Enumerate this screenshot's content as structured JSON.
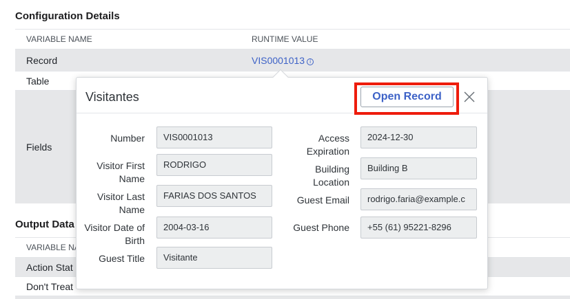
{
  "config": {
    "title": "Configuration Details",
    "col_name": "VARIABLE NAME",
    "col_value": "RUNTIME VALUE",
    "rows": [
      {
        "name": "Record",
        "value": "VIS0001013"
      },
      {
        "name": "Table",
        "value": ""
      },
      {
        "name": "Fields",
        "value": ""
      }
    ],
    "info_icon": "i"
  },
  "output": {
    "title": "Output Data",
    "col_name": "VARIABLE NA",
    "rows": [
      {
        "name": "Action Stat"
      },
      {
        "name": "Don't Treat"
      }
    ]
  },
  "popup": {
    "title": "Visitantes",
    "open_record_label": "Open Record",
    "close_icon": "close-icon",
    "highlight_color": "#ee1c0c",
    "left_fields": [
      {
        "label": "Number",
        "value": "VIS0001013"
      },
      {
        "label": "Visitor First Name",
        "value": "RODRIGO"
      },
      {
        "label": "Visitor Last Name",
        "value": "FARIAS DOS SANTOS"
      },
      {
        "label": "Visitor Date of Birth",
        "value": "2004-03-16"
      },
      {
        "label": "Guest Title",
        "value": "Visitante"
      }
    ],
    "right_fields": [
      {
        "label": "Access Expiration",
        "value": "2024-12-30"
      },
      {
        "label": "Building Location",
        "value": "Building B"
      },
      {
        "label": "Guest Email",
        "value": "rodrigo.faria@example.c"
      },
      {
        "label": "Guest Phone",
        "value": "+55 (61) 95221-8296"
      }
    ]
  }
}
